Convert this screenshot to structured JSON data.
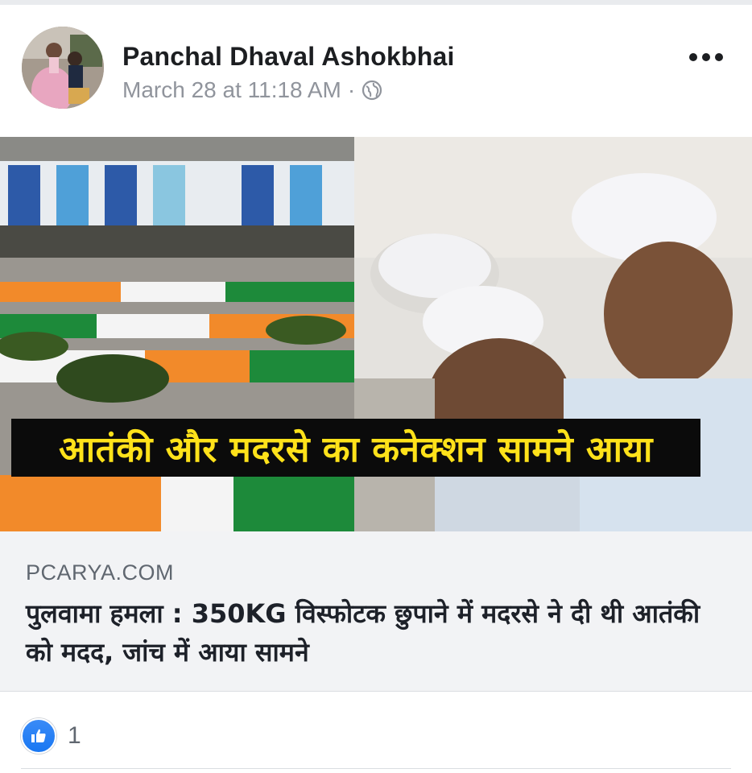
{
  "post": {
    "author": "Panchal Dhaval Ashokbhai",
    "timestamp": "March 28 at 11:18 AM",
    "separator": "·",
    "privacy_icon": "globe-icon",
    "more_icon": "more-options-icon"
  },
  "image": {
    "overlay_text": "आतंकी और मदरसे का कनेक्शन सामने आया"
  },
  "link_preview": {
    "domain": "PCARYA.COM",
    "headline": "पुलवामा हमला : 350KG विस्फोटक छुपाने में मदरसे ने दी थी आतंकी को मदद, जांच में आया सामने"
  },
  "reactions": {
    "icon": "like-icon",
    "count": "1"
  },
  "colors": {
    "brand_blue": "#1877f2",
    "banner_text": "#ffe21a",
    "banner_bg": "#0b0b0b"
  }
}
